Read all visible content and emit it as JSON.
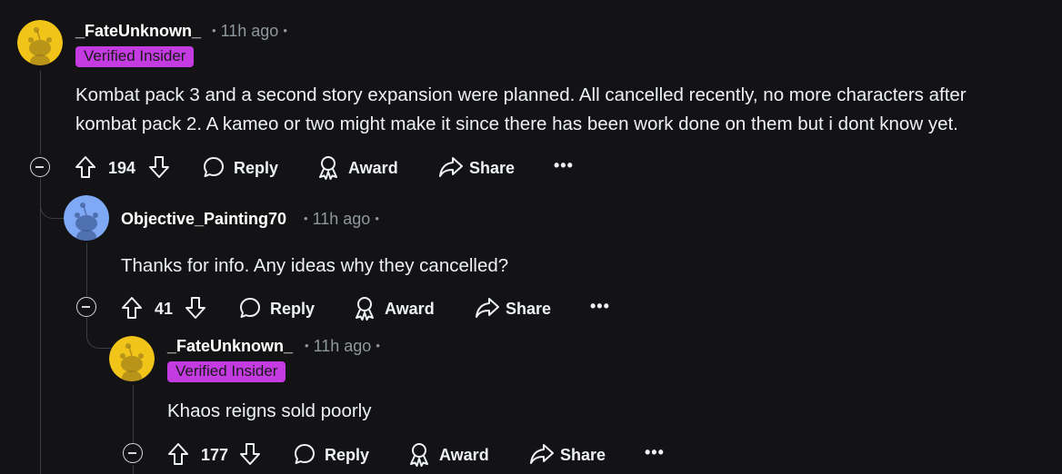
{
  "comments": [
    {
      "username": "_FateUnknown_",
      "time": "11h ago",
      "flair": "Verified Insider",
      "text_lines": [
        "Kombat pack 3 and a second story expansion were planned. All cancelled recently, no more characters after",
        "kombat pack 2. A kameo or two might make it since there has been work done on them but i dont know yet."
      ],
      "votes": "194",
      "avatar_color": "#f0c419"
    },
    {
      "username": "Objective_Painting70",
      "time": "11h ago",
      "text_lines": [
        "Thanks for info. Any ideas why they cancelled?"
      ],
      "votes": "41",
      "avatar_color": "#7fa9f5"
    },
    {
      "username": "_FateUnknown_",
      "time": "11h ago",
      "flair": "Verified Insider",
      "text_lines": [
        "Khaos reigns sold poorly"
      ],
      "votes": "177",
      "avatar_color": "#f0c419"
    }
  ],
  "actions": {
    "reply": "Reply",
    "award": "Award",
    "share": "Share",
    "more": "•••"
  },
  "colors": {
    "background": "#131315",
    "flair": "#c43ce1",
    "meta": "#8f989e",
    "thread_line": "#3a3f44"
  },
  "icons": [
    "upvote-icon",
    "downvote-icon",
    "reply-icon",
    "award-icon",
    "share-icon",
    "collapse-icon",
    "more-icon"
  ]
}
